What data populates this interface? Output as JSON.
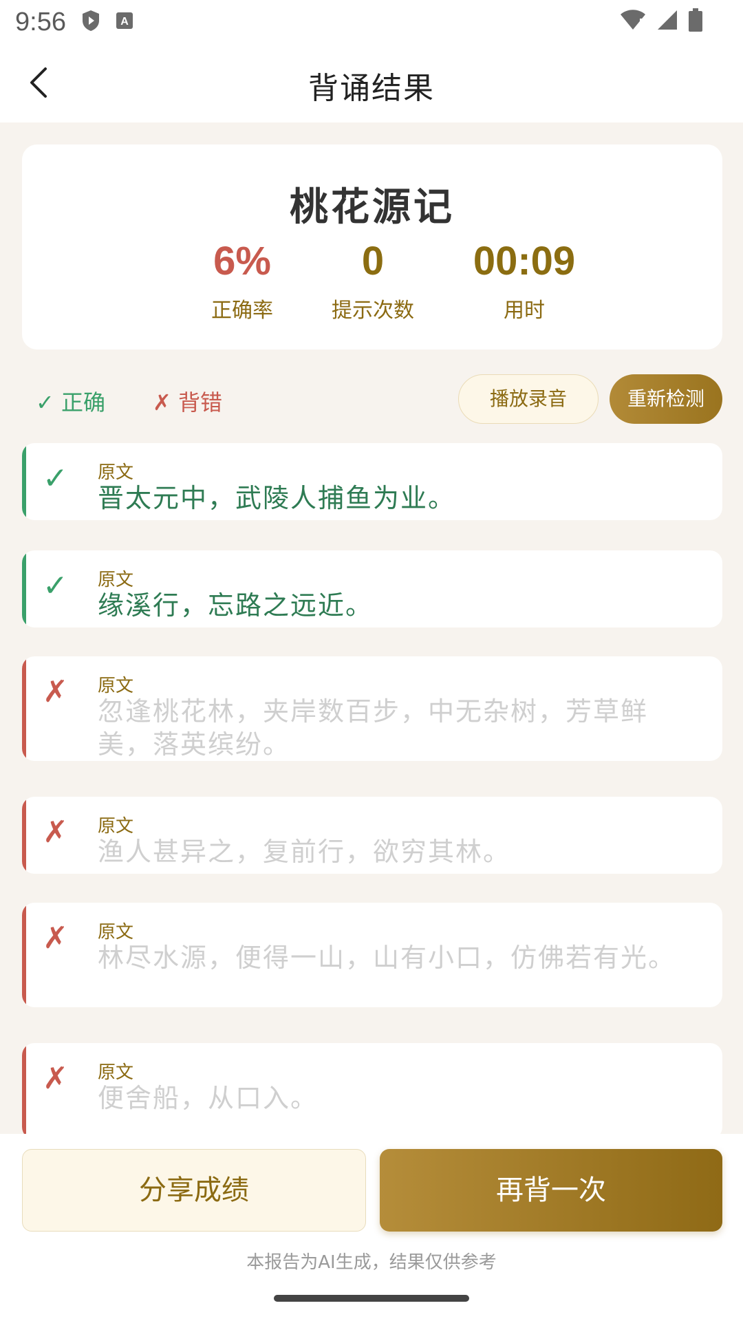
{
  "status_bar": {
    "time": "9:56"
  },
  "header": {
    "title": "背诵结果"
  },
  "score": {
    "poem_title": "桃花源记",
    "accuracy": {
      "value": "6%",
      "label": "正确率"
    },
    "hints": {
      "value": "0",
      "label": "提示次数"
    },
    "time": {
      "value": "00:09",
      "label": "用时"
    }
  },
  "legend": {
    "correct": "✓ 正确",
    "wrong": "✗ 背错"
  },
  "actions": {
    "play_recording": "播放录音",
    "recheck": "重新检测"
  },
  "items": [
    {
      "status": "correct",
      "mark": "✓",
      "label": "原文",
      "text": "晋太元中，武陵人捕鱼为业。"
    },
    {
      "status": "correct",
      "mark": "✓",
      "label": "原文",
      "text": "缘溪行，忘路之远近。"
    },
    {
      "status": "wrong",
      "mark": "✗",
      "label": "原文",
      "text": "忽逢桃花林，夹岸数百步，中无杂树，芳草鲜美，落英缤纷。"
    },
    {
      "status": "wrong",
      "mark": "✗",
      "label": "原文",
      "text": "渔人甚异之，复前行，欲穷其林。"
    },
    {
      "status": "wrong",
      "mark": "✗",
      "label": "原文",
      "text": "林尽水源，便得一山，山有小口，仿佛若有光。"
    },
    {
      "status": "wrong",
      "mark": "✗",
      "label": "原文",
      "text": "便舍船，从口入。"
    }
  ],
  "footer": {
    "share": "分享成绩",
    "again": "再背一次",
    "disclaimer": "本报告为AI生成，结果仅供参考"
  },
  "colors": {
    "correct": "#3aa06a",
    "wrong": "#c85a4e",
    "gold": "#8b6a12"
  }
}
